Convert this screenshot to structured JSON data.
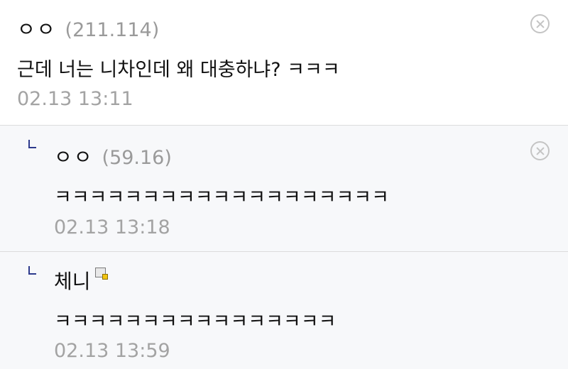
{
  "comments": [
    {
      "nickname": "ㅇㅇ",
      "ip": "(211.114)",
      "text": "근데 너는 니차인데 왜 대충하냐? ㅋㅋㅋ",
      "time": "02.13 13:11"
    }
  ],
  "replies": [
    {
      "nickname": "ㅇㅇ",
      "ip": "(59.16)",
      "text": "ㅋㅋㅋㅋㅋㅋㅋㅋㅋㅋㅋㅋㅋㅋㅋㅋㅋㅋㅋ",
      "time": "02.13 13:18"
    },
    {
      "nickname": "체니",
      "text": "ㅋㅋㅋㅋㅋㅋㅋㅋㅋㅋㅋㅋㅋㅋㅋㅋ",
      "time": "02.13 13:59"
    }
  ],
  "icons": {
    "delete": "close-circle-icon",
    "reply": "reply-arrow-icon",
    "member_badge": "fixed-nick-badge-icon"
  },
  "colors": {
    "reply_arrow": "#2d3a8c",
    "ip_text": "#9a9a9a",
    "timestamp": "#a3a3a3",
    "reply_background": "#f7f8fa"
  }
}
